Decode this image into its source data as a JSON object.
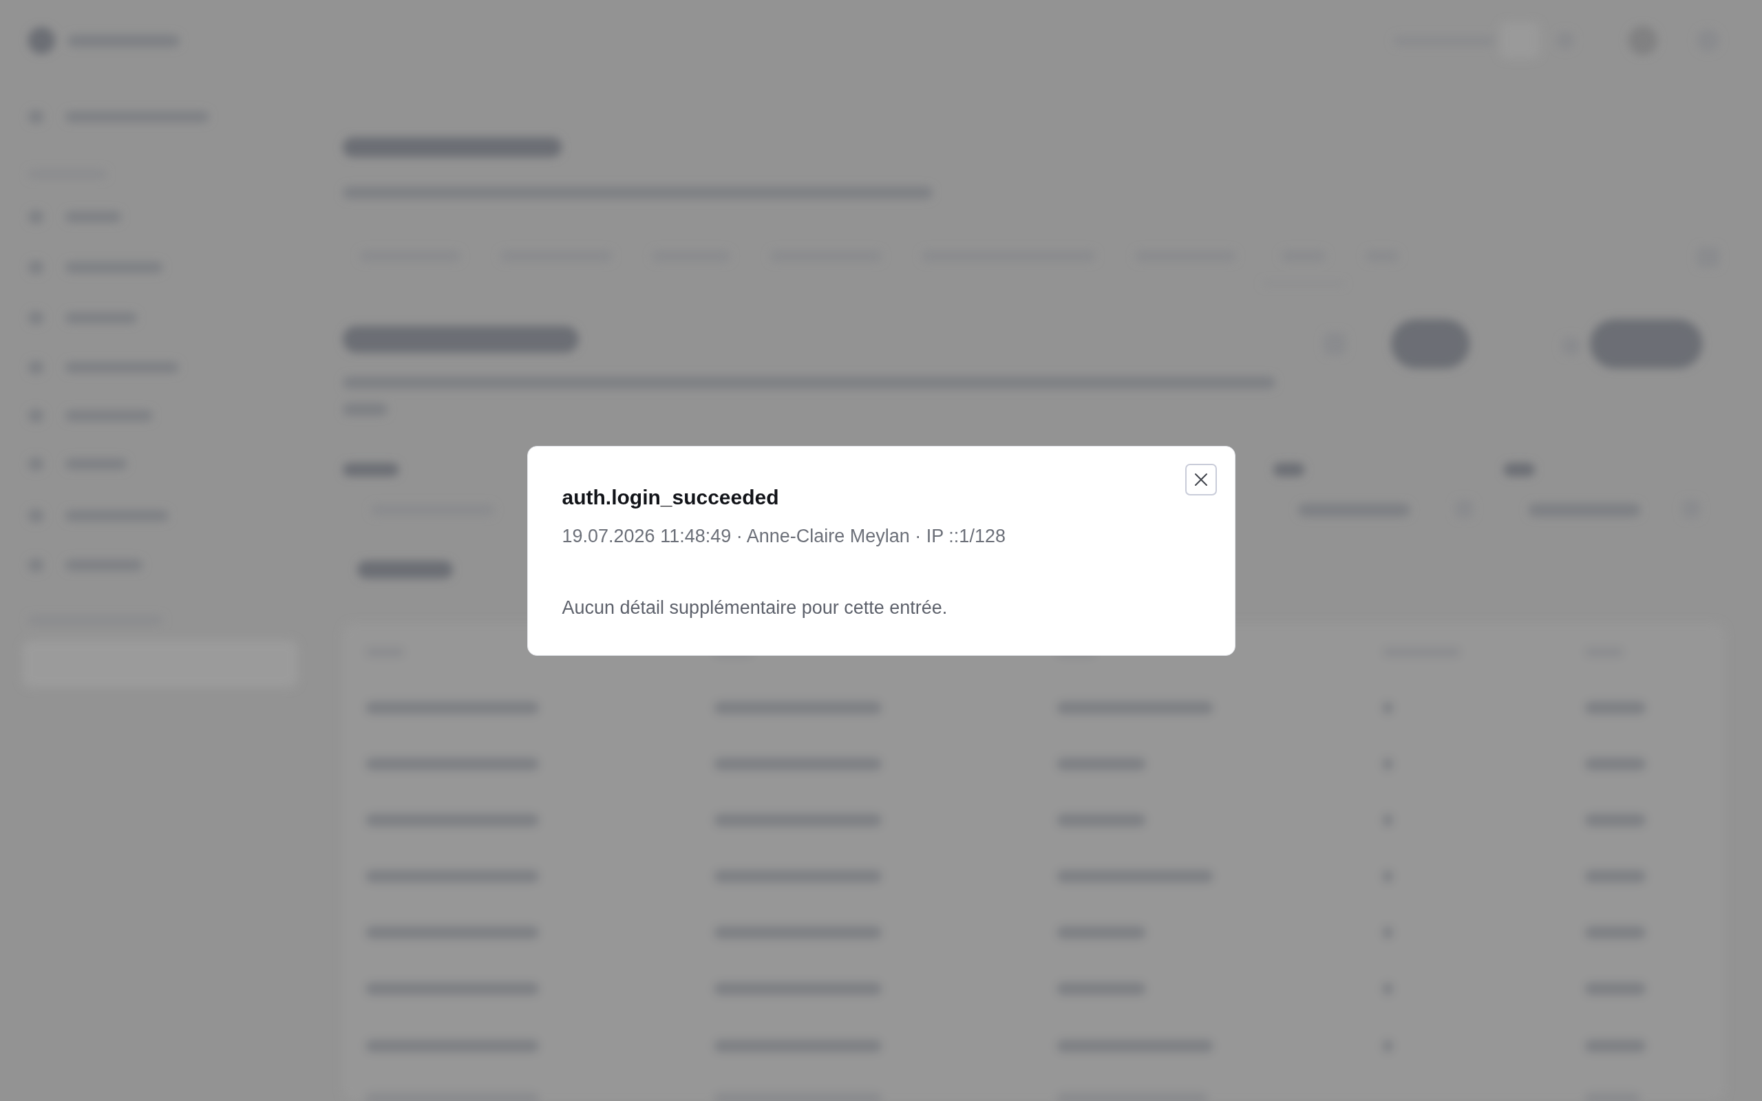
{
  "dialog": {
    "title": "auth.login_succeeded",
    "meta": "19.07.2026 11:48:49 · Anne-Claire Meylan · IP ::1/128",
    "message": "Aucun détail supplémentaire pour cette entrée."
  }
}
